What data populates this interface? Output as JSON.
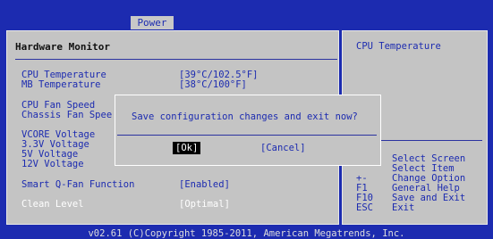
{
  "menu": {
    "active_tab": "Power"
  },
  "main": {
    "title": "Hardware Monitor",
    "rows": [
      {
        "label": "CPU Temperature",
        "value": "[39°C/102.5°F]"
      },
      {
        "label": "MB Temperature",
        "value": "[38°C/100°F]"
      },
      {
        "label": "CPU Fan Speed",
        "value": ""
      },
      {
        "label": "Chassis Fan Spee",
        "value": ""
      },
      {
        "label": "VCORE Voltage",
        "value": ""
      },
      {
        "label": "3.3V Voltage",
        "value": ""
      },
      {
        "label": "5V Voltage",
        "value": ""
      },
      {
        "label": "12V Voltage",
        "value": ""
      },
      {
        "label": "Smart Q-Fan Function",
        "value": "[Enabled]"
      },
      {
        "label": "Clean Level",
        "value": "[Optimal]"
      }
    ]
  },
  "help": {
    "title": "CPU Temperature",
    "keys": [
      {
        "key": "",
        "desc": "Select Screen"
      },
      {
        "key": "",
        "desc": "Select Item"
      },
      {
        "key": "+-",
        "desc": "Change Option"
      },
      {
        "key": "F1",
        "desc": "General Help"
      },
      {
        "key": "F10",
        "desc": "Save and Exit"
      },
      {
        "key": "ESC",
        "desc": "Exit"
      }
    ]
  },
  "dialog": {
    "message": "Save configuration changes and exit now?",
    "ok_label": "[Ok]",
    "cancel_label": "[Cancel]"
  },
  "footer": {
    "copyright": "v02.61 (C)Copyright 1985-2011, American Megatrends, Inc."
  },
  "colors": {
    "background": "#1c2bb0",
    "panel": "#c4c4c4",
    "text": "#1c2bb0",
    "selected_text": "#ffffff"
  }
}
